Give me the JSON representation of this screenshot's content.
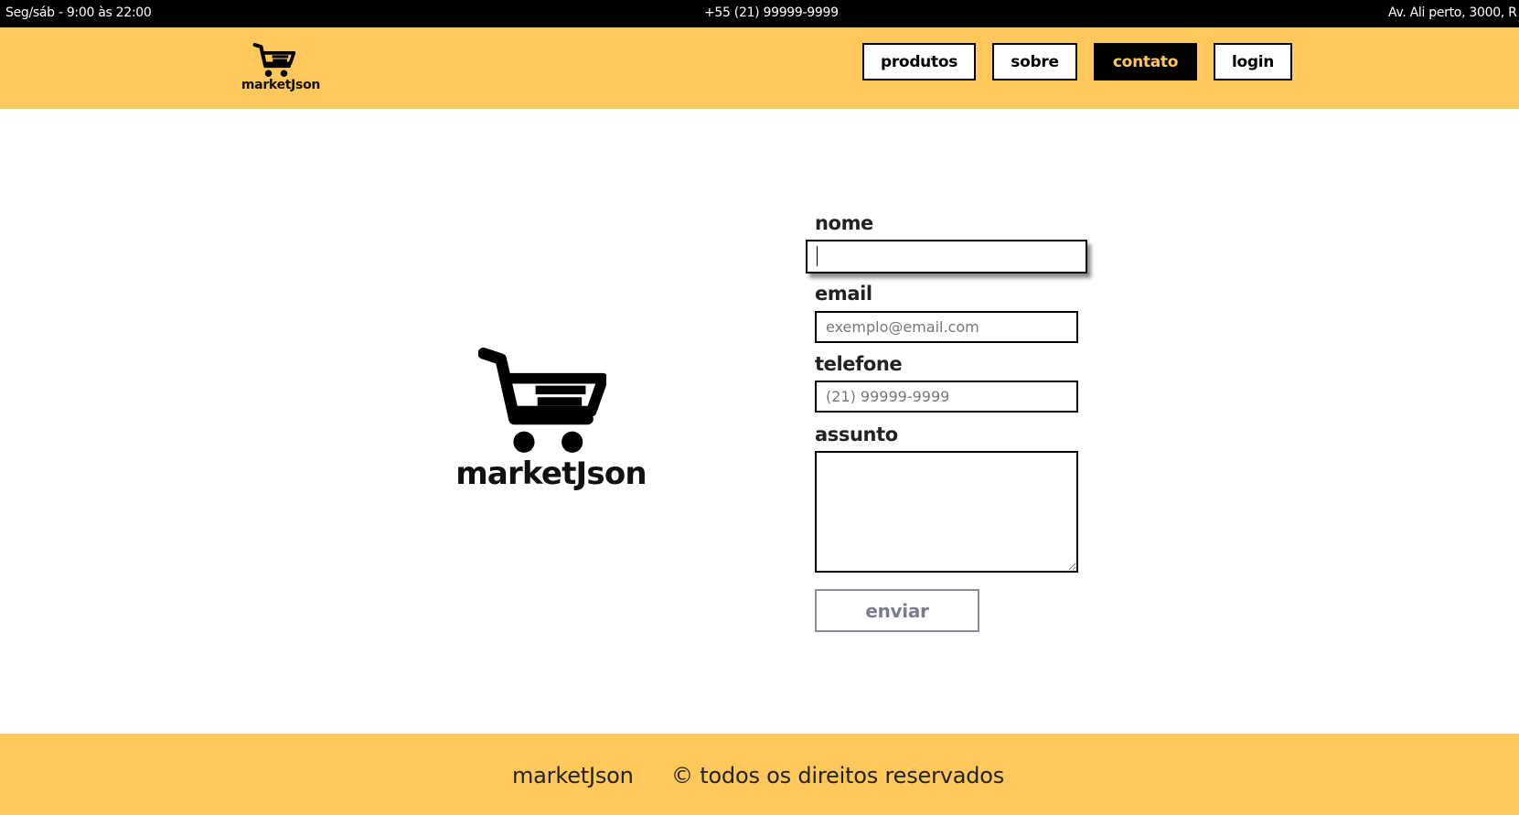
{
  "topbar": {
    "hours": "Seg/sáb - 9:00 às 22:00",
    "phone": "+55 (21) 99999-9999",
    "address": "Av. Ali perto, 3000, R"
  },
  "header": {
    "brand": "marketJson",
    "nav": [
      {
        "label": "produtos",
        "active": false
      },
      {
        "label": "sobre",
        "active": false
      },
      {
        "label": "contato",
        "active": true
      },
      {
        "label": "login",
        "active": false
      }
    ]
  },
  "hero": {
    "brand": "marketJson"
  },
  "form": {
    "nome": {
      "label": "nome",
      "value": "",
      "placeholder": ""
    },
    "email": {
      "label": "email",
      "value": "",
      "placeholder": "exemplo@email.com"
    },
    "telefone": {
      "label": "telefone",
      "value": "",
      "placeholder": "(21) 99999-9999"
    },
    "assunto": {
      "label": "assunto",
      "value": ""
    },
    "submit_label": "enviar"
  },
  "footer": {
    "brand": "marketJson",
    "rights": "© todos os direitos reservados"
  },
  "colors": {
    "accent": "#ffc85c",
    "dark": "#000000",
    "disabled_text": "#7b7e8a"
  },
  "icons": {
    "logo": "shopping-cart-icon"
  }
}
